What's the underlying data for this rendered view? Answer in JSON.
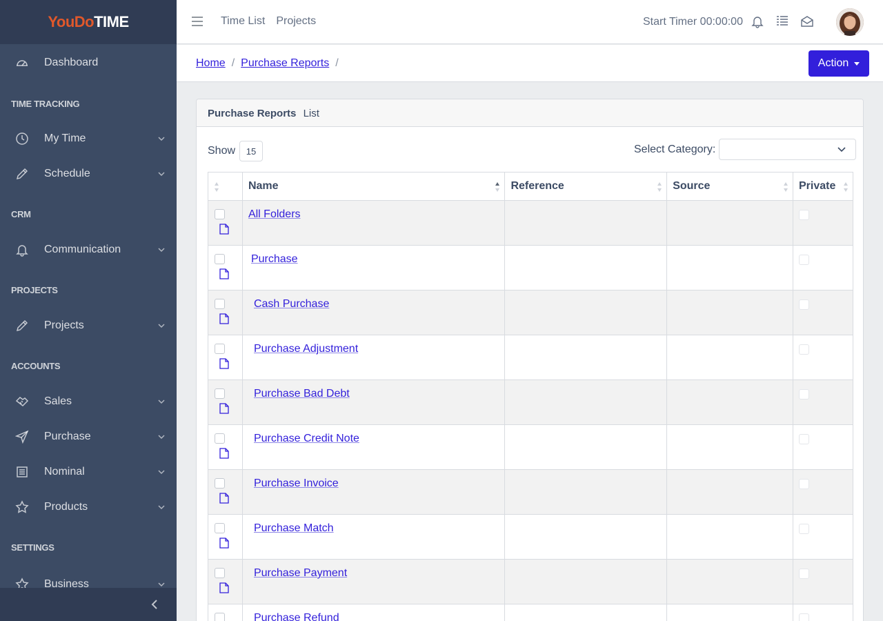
{
  "brand": {
    "part1": "YouDo",
    "part2": "TIME"
  },
  "sidebar": {
    "dashboard": "Dashboard",
    "sections": {
      "time_tracking": "TIME TRACKING",
      "crm": "CRM",
      "projects": "PROJECTS",
      "accounts": "ACCOUNTS",
      "settings": "SETTINGS"
    },
    "items": {
      "my_time": "My Time",
      "schedule": "Schedule",
      "communication": "Communication",
      "projects": "Projects",
      "sales": "Sales",
      "purchase": "Purchase",
      "nominal": "Nominal",
      "products": "Products",
      "business": "Business"
    }
  },
  "header": {
    "nav": [
      "Time List",
      "Projects"
    ],
    "timer": "Start Timer 00:00:00"
  },
  "breadcrumb": {
    "home": "Home",
    "current": "Purchase Reports",
    "sep": "/"
  },
  "action_label": "Action",
  "card": {
    "title": "Purchase Reports",
    "subtitle": "List"
  },
  "controls": {
    "show_label": "Show",
    "show_value": "15",
    "category_label": "Select Category:",
    "category_value": ""
  },
  "table": {
    "headers": {
      "name": "Name",
      "reference": "Reference",
      "source": "Source",
      "private": "Private"
    },
    "rows": [
      {
        "name": "All Folders",
        "reference": "",
        "source": ""
      },
      {
        "name": "Purchase",
        "reference": "",
        "source": ""
      },
      {
        "name": "Cash Purchase",
        "reference": "",
        "source": ""
      },
      {
        "name": "Purchase Adjustment",
        "reference": "",
        "source": ""
      },
      {
        "name": "Purchase Bad Debt",
        "reference": "",
        "source": ""
      },
      {
        "name": "Purchase Credit Note",
        "reference": "",
        "source": ""
      },
      {
        "name": "Purchase Invoice",
        "reference": "",
        "source": ""
      },
      {
        "name": "Purchase Match",
        "reference": "",
        "source": ""
      },
      {
        "name": "Purchase Payment",
        "reference": "",
        "source": ""
      },
      {
        "name": "Purchase Refund",
        "reference": "",
        "source": ""
      }
    ]
  },
  "colors": {
    "primary": "#321fdb",
    "sidebar": "#3c4b64",
    "brand_accent": "#e0582b"
  }
}
